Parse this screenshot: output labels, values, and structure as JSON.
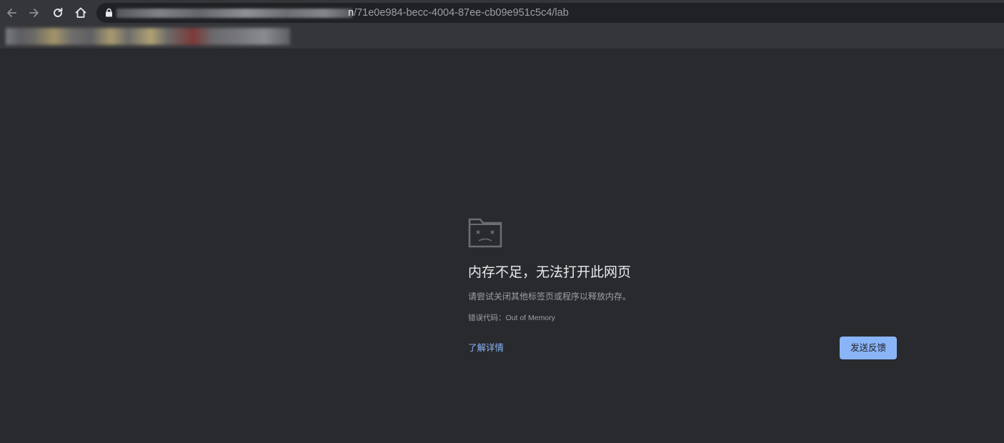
{
  "browser": {
    "url_visible_suffix": "71e0e984-becc-4004-87ee-cb09e951c5c4/lab",
    "url_host_tail": "n",
    "icons": [
      "back-arrow-icon",
      "forward-arrow-icon",
      "reload-icon",
      "home-icon",
      "lock-icon"
    ]
  },
  "error_page": {
    "icon": "sad-folder-icon",
    "title": "内存不足，无法打开此网页",
    "hint": "请尝试关闭其他标签页或程序以释放内存。",
    "error_code": "错误代码：Out of Memory",
    "learn_more_label": "了解详情",
    "feedback_label": "发送反馈"
  },
  "colors": {
    "toolbar_bg": "#35363a",
    "omnibox_bg": "#202124",
    "page_bg": "#292a2d",
    "link": "#8ab4f8",
    "button_bg": "#8ab4f8",
    "title_text": "#e8eaed",
    "secondary_text": "#9aa0a6"
  }
}
